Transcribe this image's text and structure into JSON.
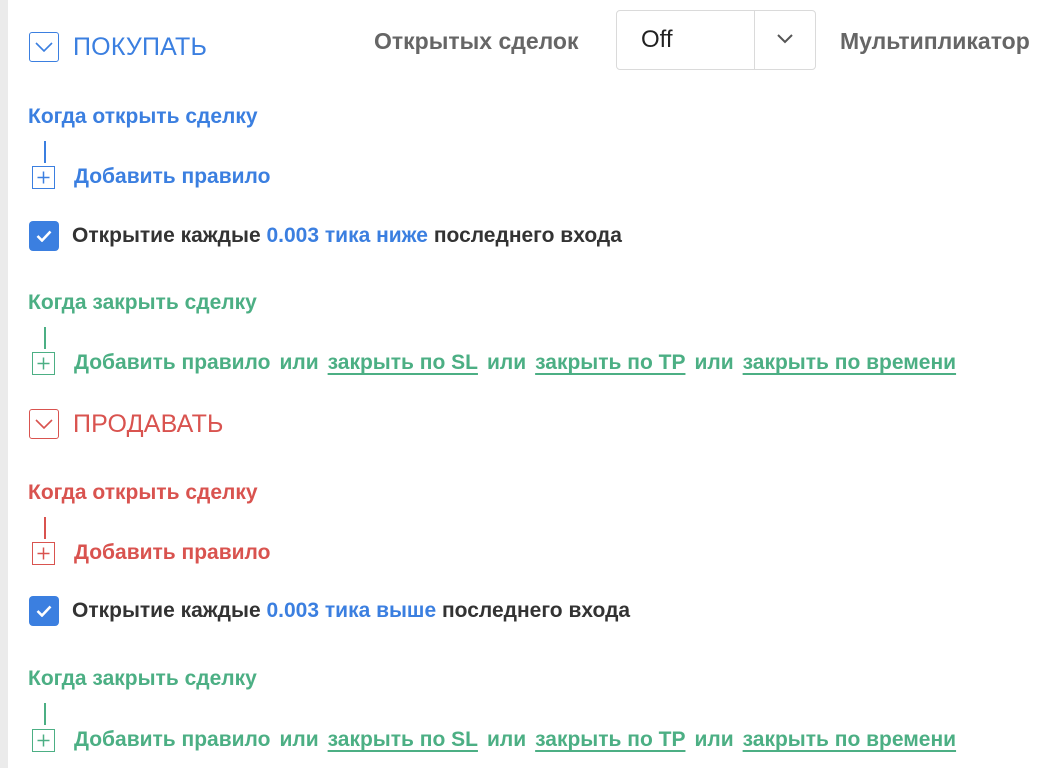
{
  "header": {
    "open_trades_label": "Открытых сделок",
    "open_trades_value": "Off",
    "multiplier_label": "Мультипликатор"
  },
  "buy": {
    "title": "ПОКУПАТЬ",
    "open_heading": "Когда открыть сделку",
    "open_add_rule": "Добавить правило",
    "step_rule": {
      "checked": true,
      "prefix": "Открытие каждые",
      "value": "0.003",
      "unit_direction": "тика ниже",
      "suffix": "последнего входа"
    },
    "close_heading": "Когда закрыть сделку",
    "close_add_rule": "Добавить правило",
    "or_1": "или",
    "close_sl": "закрыть по SL",
    "or_2": "или",
    "close_tp": "закрыть по TP",
    "or_3": "или",
    "close_time": "закрыть по времени"
  },
  "sell": {
    "title": "ПРОДАВАТЬ",
    "open_heading": "Когда открыть сделку",
    "open_add_rule": "Добавить правило",
    "step_rule": {
      "checked": true,
      "prefix": "Открытие каждые",
      "value": "0.003",
      "unit_direction": "тика выше",
      "suffix": "последнего входа"
    },
    "close_heading": "Когда закрыть сделку",
    "close_add_rule": "Добавить правило",
    "or_1": "или",
    "close_sl": "закрыть по SL",
    "or_2": "или",
    "close_tp": "закрыть по TP",
    "or_3": "или",
    "close_time": "закрыть по времени"
  },
  "colors": {
    "buy_accent": "#3b7fe0",
    "sell_accent": "#d9534f",
    "close_accent": "#4caf84",
    "checkbox": "#3b7fe0"
  },
  "icons": {
    "section_toggle": "chevron-down-icon",
    "add_rule": "plus-icon",
    "checkbox": "checkmark-icon",
    "dropdown": "chevron-down-icon"
  }
}
